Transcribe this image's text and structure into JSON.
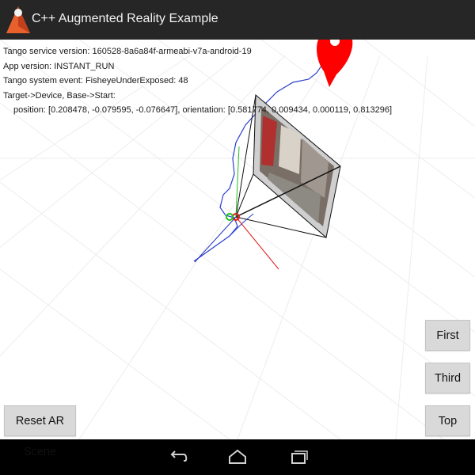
{
  "app": {
    "title": "C++ Augmented Reality Example"
  },
  "info": {
    "service_version": "Tango service version: 160528-8a6a84f-armeabi-v7a-android-19",
    "app_version": "App version: INSTANT_RUN",
    "system_event": "Tango system event: FisheyeUnderExposed: 48",
    "target_label": "Target->Device, Base->Start:",
    "pose": "position: [0.208478, -0.079595, -0.076647], orientation: [0.581774, 0.009434, 0.000119, 0.813296]"
  },
  "buttons": {
    "first": "First",
    "third": "Third",
    "top": "Top",
    "reset": "Reset AR Scene"
  },
  "icons": {
    "app": "tango-logo-icon",
    "marker": "location-marker-icon",
    "back": "back-arrow-icon",
    "home": "home-icon",
    "recent": "recent-apps-icon"
  },
  "colors": {
    "titlebar": "#262626",
    "navbar": "#000000",
    "marker": "#ff0000",
    "trajectory": "#2a3fd0",
    "axis_x": "#e02020",
    "axis_y": "#20c020",
    "axis_z": "#2030c0",
    "button_bg": "#d9d9d9"
  }
}
